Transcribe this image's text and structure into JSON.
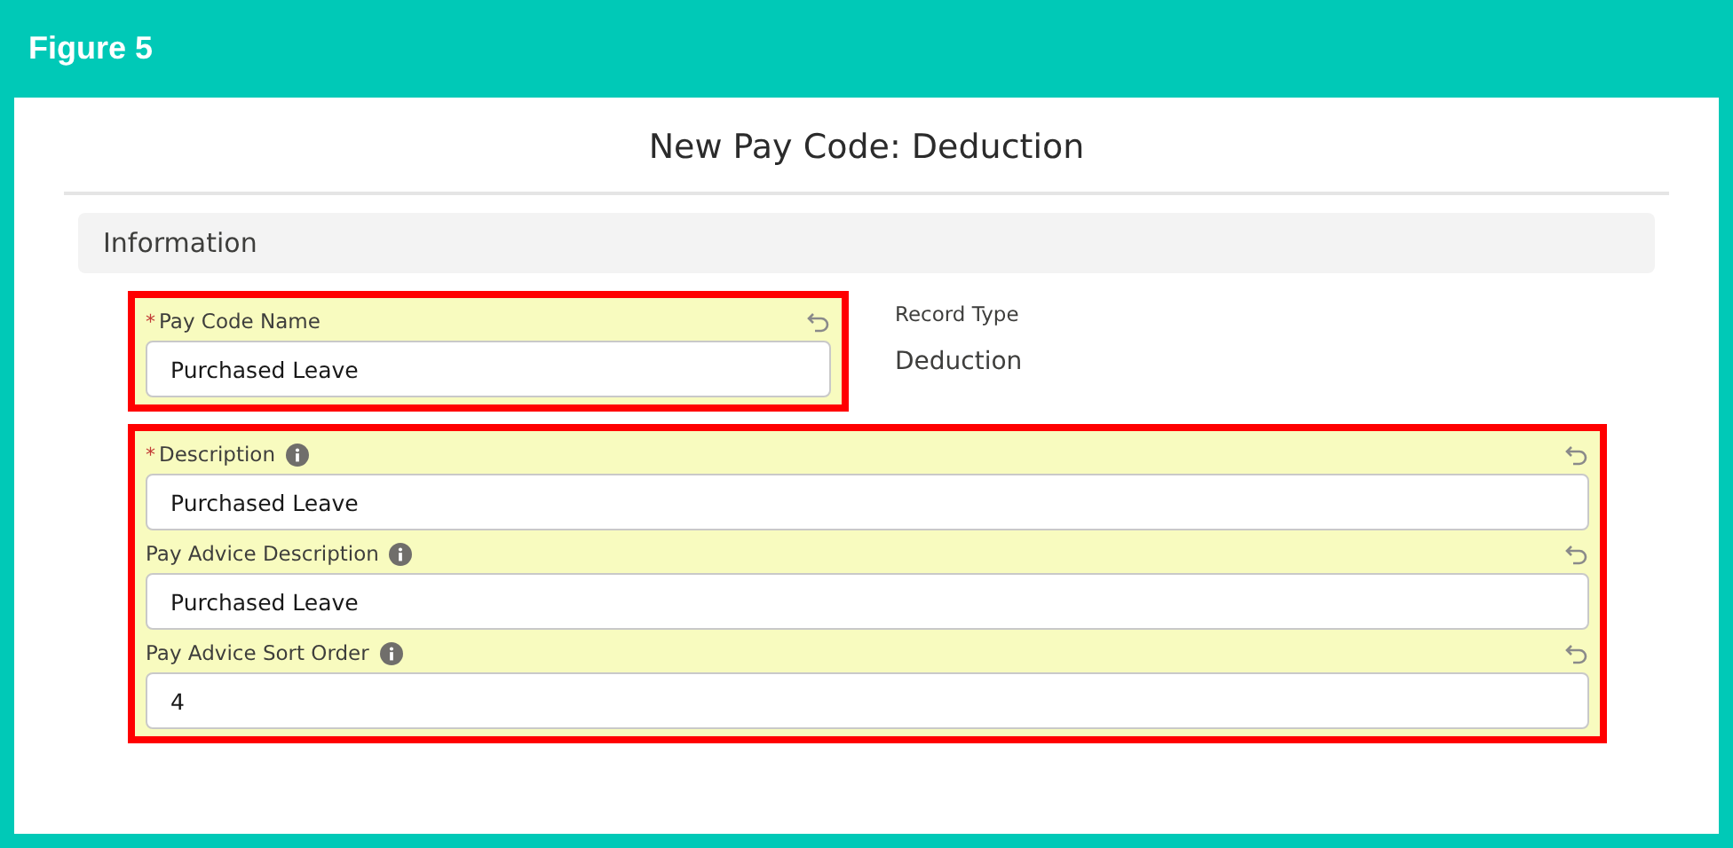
{
  "figure_label": "Figure 5",
  "modal_title": "New Pay Code: Deduction",
  "section": {
    "title": "Information"
  },
  "groups": [
    {
      "highlighted": true,
      "fields": [
        {
          "label": "Pay Code Name",
          "required_mark": "*",
          "info": false,
          "value": "Purchased Leave"
        }
      ]
    },
    {
      "highlighted": true,
      "fields": [
        {
          "label": "Description",
          "required_mark": "*",
          "info": true,
          "value": "Purchased Leave"
        },
        {
          "label": "Pay Advice Description",
          "info": true,
          "value": "Purchased Leave"
        },
        {
          "label": "Pay Advice Sort Order",
          "info": true,
          "value": "4"
        }
      ]
    }
  ],
  "record_type": {
    "label": "Record Type",
    "value": "Deduction"
  }
}
